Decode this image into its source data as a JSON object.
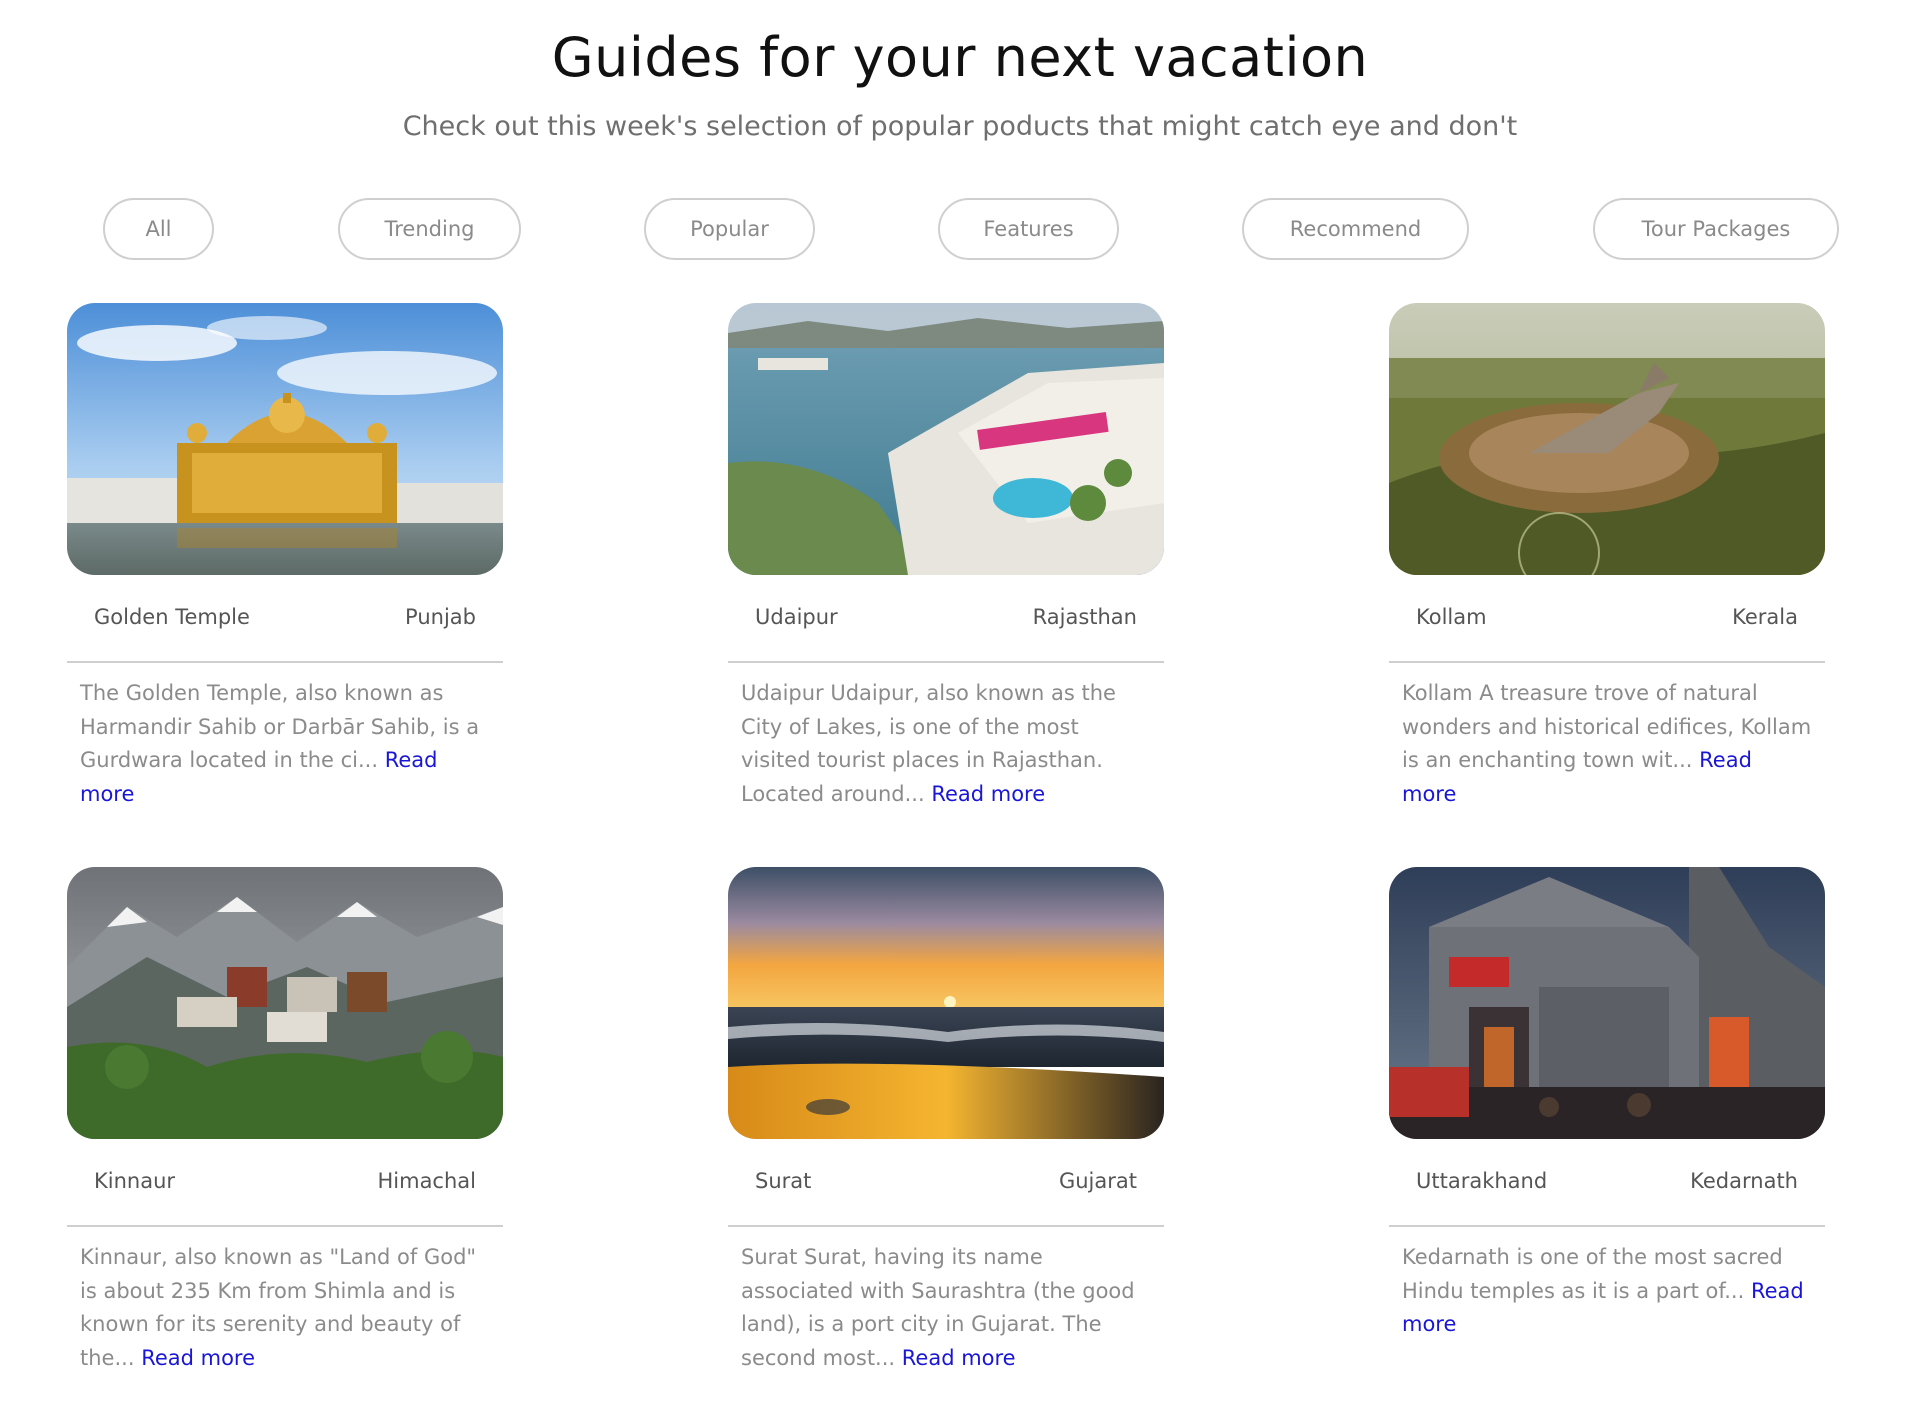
{
  "header": {
    "title": "Guides for your next vacation",
    "subtitle": "Check out this week's selection of popular poducts that might catch eye and don't"
  },
  "filters": [
    "All",
    "Trending",
    "Popular",
    "Features",
    "Recommend",
    "Tour Packages"
  ],
  "cards": [
    {
      "place": "Golden Temple",
      "region": "Punjab",
      "description": "The Golden Temple, also known as Harmandir Sahib or Darbār Sahib, is a Gurdwara located in the ci...",
      "read_more": "Read more",
      "image": "golden-temple-photo"
    },
    {
      "place": "Udaipur",
      "region": "Rajasthan",
      "description": "Udaipur Udaipur, also known as the City of Lakes, is one of the most visited tourist places in Rajasthan. Located around...",
      "read_more": "Read more",
      "image": "udaipur-lake-palace-photo"
    },
    {
      "place": "Kollam",
      "region": "Kerala",
      "description": "Kollam A treasure trove of natural wonders and historical edifices, Kollam is an enchanting town wit...",
      "read_more": "Read more",
      "image": "kollam-jatayu-sculpture-photo"
    },
    {
      "place": "Kinnaur",
      "region": "Himachal",
      "description": "Kinnaur, also known as \"Land of God\" is about 235 Km from Shimla and is known for its serenity and beauty of the...",
      "read_more": "Read more",
      "image": "kinnaur-mountain-village-photo"
    },
    {
      "place": "Surat",
      "region": "Gujarat",
      "description": "Surat Surat, having its name associated with Saurashtra (the good land), is a port city in Gujarat. The second most...",
      "read_more": "Read more",
      "image": "surat-beach-sunset-photo"
    },
    {
      "place": "Uttarakhand",
      "region": "Kedarnath",
      "description": "Kedarnath is one of the most sacred Hindu temples as it is a part of...",
      "read_more": "Read more",
      "image": "kedarnath-temple-photo"
    }
  ],
  "colors": {
    "link": "#1a16d6",
    "muted_text": "#8b8b8b",
    "border": "#cfcfcf"
  }
}
